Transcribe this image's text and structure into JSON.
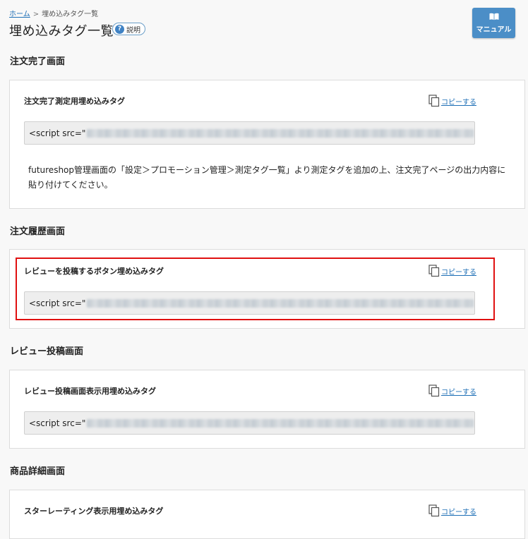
{
  "breadcrumb": {
    "home": "ホーム",
    "separator": ">",
    "current": "埋め込みタグ一覧"
  },
  "page_title": "埋め込みタグ一覧",
  "help_badge": {
    "icon": "?",
    "label": "説明"
  },
  "manual_button": {
    "label": "マニュアル",
    "icon": "book-icon"
  },
  "colors": {
    "accent": "#4b8ec7",
    "link": "#1e6fb6",
    "highlight": "#e01010"
  },
  "sections": [
    {
      "title": "注文完了画面",
      "card": {
        "label": "注文完了測定用埋め込みタグ",
        "copy_label": "コピーする",
        "code_prefix": "<script src=\"",
        "description": "futureshop管理画面の「設定＞プロモーション管理＞測定タグ一覧」より測定タグを追加の上、注文完了ページの出力内容に貼り付けてください。"
      }
    },
    {
      "title": "注文履歴画面",
      "card": {
        "label": "レビューを投稿するボタン埋め込みタグ",
        "copy_label": "コピーする",
        "code_prefix": "<script src=\""
      }
    },
    {
      "title": "レビュー投稿画面",
      "card": {
        "label": "レビュー投稿画面表示用埋め込みタグ",
        "copy_label": "コピーする",
        "code_prefix": "<script src=\""
      }
    },
    {
      "title": "商品詳細画面",
      "card": {
        "label": "スターレーティング表示用埋め込みタグ",
        "copy_label": "コピーする"
      }
    }
  ]
}
